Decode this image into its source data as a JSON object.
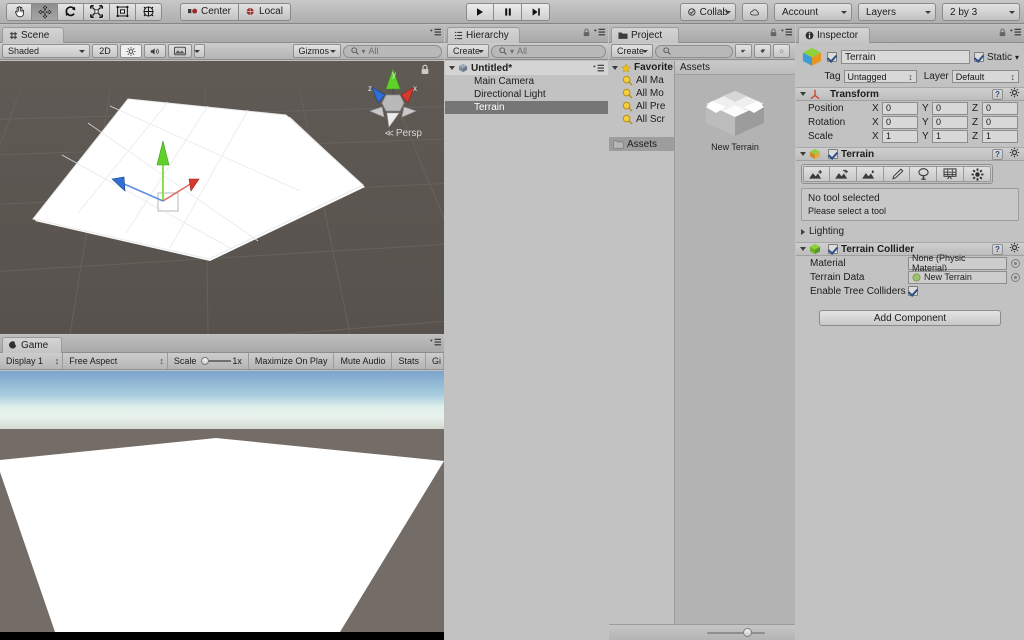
{
  "toolbar": {
    "tools": [
      {
        "name": "hand-tool",
        "label": "Hand",
        "active": false
      },
      {
        "name": "move-tool",
        "label": "Move",
        "active": true
      },
      {
        "name": "rotate-tool",
        "label": "Rotate",
        "active": false
      },
      {
        "name": "scale-tool",
        "label": "Scale",
        "active": false
      },
      {
        "name": "rect-tool",
        "label": "Rect",
        "active": false
      },
      {
        "name": "transform-tool",
        "label": "Transform",
        "active": false
      }
    ],
    "pivot_mode": "Center",
    "pivot_rotation": "Local",
    "play": "play-icon",
    "pause": "pause-icon",
    "step": "step-icon",
    "collab": "Collab",
    "cloud": "cloud-icon",
    "account": "Account",
    "layers": "Layers",
    "layout": "2 by 3"
  },
  "scene": {
    "tab": "Scene",
    "shading": "Shaded",
    "mode_2d": "2D",
    "lighting_icon": "sun-icon",
    "audio_icon": "speaker-icon",
    "effects_icon": "image-icon",
    "gizmos": "Gizmos",
    "search_placeholder": "All",
    "search_value": "",
    "orientation_label": "Persp",
    "axis_x": "x",
    "axis_y": "y",
    "axis_z": "z"
  },
  "game": {
    "tab": "Game",
    "display": "Display 1",
    "aspect": "Free Aspect",
    "scale_label": "Scale",
    "scale_value": "1x",
    "maximize": "Maximize On Play",
    "mute": "Mute Audio",
    "stats": "Stats",
    "gizmos": "Gi"
  },
  "hierarchy": {
    "tab": "Hierarchy",
    "create": "Create",
    "search_placeholder": "All",
    "scene_name": "Untitled*",
    "items": [
      {
        "label": "Main Camera",
        "selected": false
      },
      {
        "label": "Directional Light",
        "selected": false
      },
      {
        "label": "Terrain",
        "selected": true
      }
    ]
  },
  "project": {
    "tab": "Project",
    "create": "Create",
    "search_placeholder": "",
    "favorites_label": "Favorite",
    "favorites": [
      "All Ma",
      "All Mo",
      "All Pre",
      "All Scr"
    ],
    "folders": [
      {
        "label": "Assets",
        "selected": true
      }
    ],
    "assets_header": "Assets",
    "assets": [
      {
        "label": "New Terrain",
        "icon": "prefab-box-icon"
      }
    ]
  },
  "inspector": {
    "tab": "Inspector",
    "object_name": "Terrain",
    "object_enabled": true,
    "static_label": "Static",
    "static_checked": true,
    "tag_label": "Tag",
    "tag_value": "Untagged",
    "layer_label": "Layer",
    "layer_value": "Default",
    "transform": {
      "title": "Transform",
      "rows": [
        {
          "label": "Position",
          "x": "0",
          "y": "0",
          "z": "0"
        },
        {
          "label": "Rotation",
          "x": "0",
          "y": "0",
          "z": "0"
        },
        {
          "label": "Scale",
          "x": "1",
          "y": "1",
          "z": "1"
        }
      ],
      "axis_keys": [
        "X",
        "Y",
        "Z"
      ]
    },
    "terrain": {
      "title": "Terrain",
      "enabled": true,
      "tools": [
        "raise-lower-terrain-icon",
        "paint-height-icon",
        "smooth-height-icon",
        "paint-texture-icon",
        "place-trees-icon",
        "paint-details-icon",
        "terrain-settings-icon"
      ],
      "help_title": "No tool selected",
      "help_body": "Please select a tool",
      "lighting_label": "Lighting"
    },
    "terrain_collider": {
      "title": "Terrain Collider",
      "enabled": true,
      "material_label": "Material",
      "material_value": "None (Physic Material)",
      "terrain_data_label": "Terrain Data",
      "terrain_data_value": "New Terrain",
      "tree_colliders_label": "Enable Tree Colliders",
      "tree_colliders_checked": true
    },
    "add_component": "Add Component"
  },
  "colors": {
    "chrome": "#c2c2c2",
    "scene_bg": "#5a5550",
    "selection": "#767676",
    "axis_x": "#d63a2f",
    "axis_y": "#5fd128",
    "axis_z": "#2f6fd6",
    "sky_top": "#7ba3cc",
    "ground": "#746c66"
  }
}
